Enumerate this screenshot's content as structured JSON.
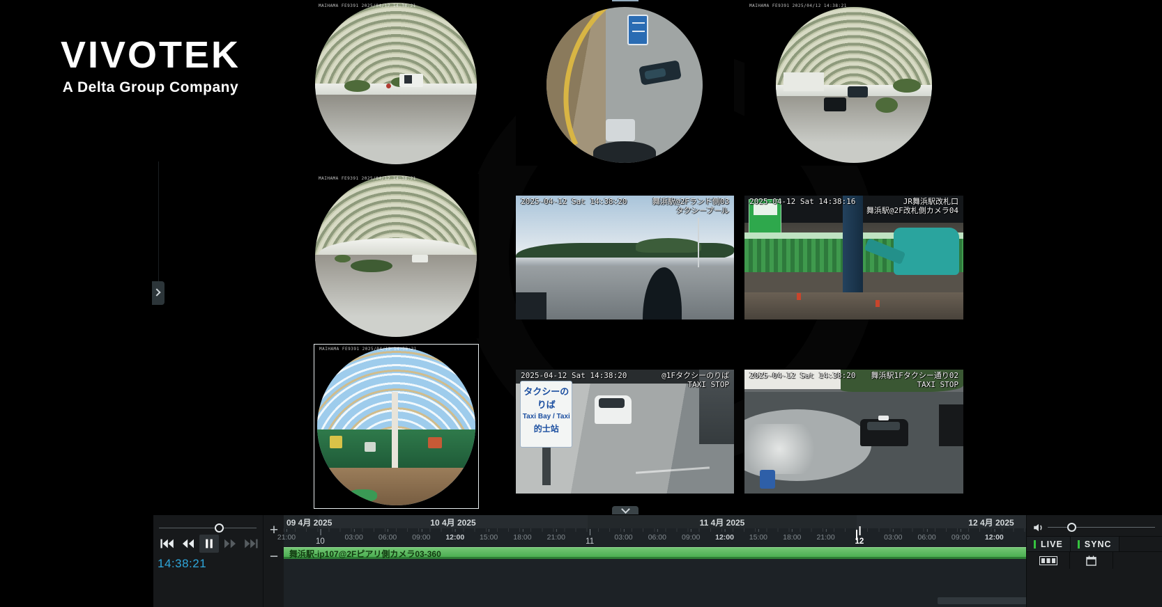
{
  "brand": {
    "logo": "VIVOTEK",
    "tagline": "A Delta Group Company"
  },
  "cameras": [
    {
      "id": 1,
      "type": "fisheye",
      "osd": "MAIHAMA FE9391 2025/04/12 14:38:21"
    },
    {
      "id": 2,
      "type": "fisheye",
      "osd": ""
    },
    {
      "id": 3,
      "type": "fisheye",
      "osd": "MAIHAMA FE9391 2025/04/12 14:38:21"
    },
    {
      "id": 4,
      "type": "fisheye",
      "osd": "MAIHAMA FE9391 2025/04/12 14:38:21"
    },
    {
      "id": 5,
      "type": "box",
      "timestamp": "2025-04-12 Sat 14:38:20",
      "label_line1": "舞浜駅@2Fランド側03",
      "label_line2": "タクシープール"
    },
    {
      "id": 6,
      "type": "box",
      "timestamp": "2025-04-12 Sat 14:38:16",
      "corner_label": "JR舞浜駅改札口",
      "label_line2": "舞浜駅@2F改札側カメラ04"
    },
    {
      "id": 7,
      "type": "fisheye",
      "selected": true,
      "osd": "MAIHAMA FE9391 2025/04/12 14:38:21"
    },
    {
      "id": 8,
      "type": "box",
      "timestamp": "2025-04-12 Sat 14:38:20",
      "label_line1": "@1Fタクシーのりば",
      "label_line2": "TAXI STOP",
      "sign": {
        "line1": "タクシーのりば",
        "line2": "Taxi Bay / Taxi",
        "line3": "的士站"
      }
    },
    {
      "id": 9,
      "type": "box",
      "timestamp": "2025-04-12 Sat 14:38:20",
      "label_line1": "舞浜駅1Fタクシー通り02",
      "label_line2": "TAXI STOP"
    }
  ],
  "playback": {
    "current_time": "14:38:21"
  },
  "timeline": {
    "zoom_in_label": "+",
    "zoom_out_label": "−",
    "days": [
      "09 4月 2025",
      "10 4月 2025",
      "11 4月 2025",
      "12 4月 2025"
    ],
    "ticks": [
      {
        "label": "21:00"
      },
      {
        "label": "10",
        "day": true
      },
      {
        "label": "03:00"
      },
      {
        "label": "06:00"
      },
      {
        "label": "09:00"
      },
      {
        "label": "12:00",
        "noon": true
      },
      {
        "label": "15:00"
      },
      {
        "label": "18:00"
      },
      {
        "label": "21:00"
      },
      {
        "label": "11",
        "day": true
      },
      {
        "label": "03:00"
      },
      {
        "label": "06:00"
      },
      {
        "label": "09:00"
      },
      {
        "label": "12:00",
        "noon": true
      },
      {
        "label": "15:00"
      },
      {
        "label": "18:00"
      },
      {
        "label": "21:00"
      },
      {
        "label": "12",
        "day": true,
        "current": true
      },
      {
        "label": "03:00"
      },
      {
        "label": "06:00"
      },
      {
        "label": "09:00"
      },
      {
        "label": "12:00",
        "noon": true
      }
    ],
    "track_label": "舞浜駅-ip107@2Fピアリ側カメラ03-360"
  },
  "right_controls": {
    "live_label": "LIVE",
    "sync_label": "SYNC"
  },
  "colors": {
    "timeline_bar": "#58ba5d",
    "time_blue": "#2fa7dc",
    "live_indicator": "#35c33f",
    "selected_border": "#e9eef0"
  }
}
